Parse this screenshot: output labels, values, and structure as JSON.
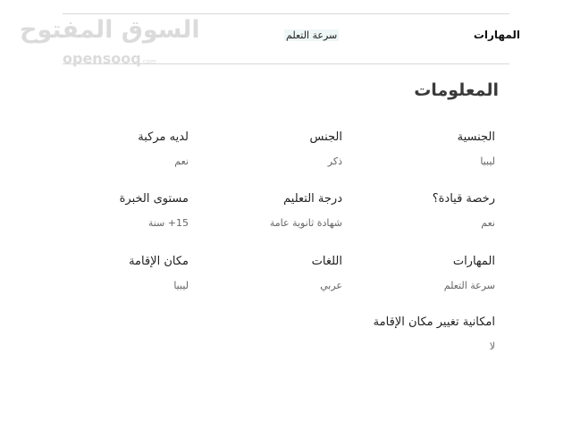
{
  "watermark": {
    "arabic": "السوق المفتوح",
    "latin": "opensooq",
    "suffix": ".com"
  },
  "top": {
    "skills_label": "المهارات",
    "skills_value": "سرعة التعلم"
  },
  "section": {
    "title": "المعلومات"
  },
  "fields": {
    "nationality": {
      "label": "الجنسية",
      "value": "ليبيا"
    },
    "gender": {
      "label": "الجنس",
      "value": "ذكر"
    },
    "has_vehicle": {
      "label": "لديه مركبة",
      "value": "نعم"
    },
    "driving_license": {
      "label": "رخصة قيادة؟",
      "value": "نعم"
    },
    "education": {
      "label": "درجة التعليم",
      "value": "شهادة ثانوية عامة"
    },
    "experience": {
      "label": "مستوى الخبرة",
      "value": "15+ سنة"
    },
    "skills": {
      "label": "المهارات",
      "value": "سرعة التعلم"
    },
    "languages": {
      "label": "اللغات",
      "value": "عربي"
    },
    "residence": {
      "label": "مكان الإقامة",
      "value": "ليبيا"
    },
    "relocation": {
      "label": "امكانية تغيير مكان الإقامة",
      "value": "لا"
    }
  }
}
